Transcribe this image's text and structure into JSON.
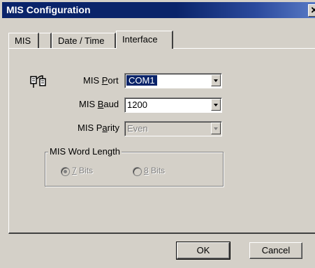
{
  "window": {
    "title": "MIS Configuration",
    "close_glyph": "✕"
  },
  "tabs": [
    {
      "label": "MIS",
      "active": false
    },
    {
      "label": "Date / Time",
      "active": false
    },
    {
      "label": "Interface",
      "active": true
    }
  ],
  "interface": {
    "port": {
      "label_pre": "MIS ",
      "label_mnemonic": "P",
      "label_post": "ort",
      "value": "COM1",
      "icon": "plug-connector-icon"
    },
    "baud": {
      "label_pre": "MIS ",
      "label_mnemonic": "B",
      "label_post": "aud",
      "value": "1200"
    },
    "parity": {
      "label_pre": "MIS P",
      "label_mnemonic": "a",
      "label_post": "rity",
      "value": "Even",
      "disabled": true
    },
    "word_length": {
      "title": "MIS Word Length",
      "options": [
        {
          "mnemonic": "7",
          "label_post": " Bits",
          "checked": true,
          "disabled": true
        },
        {
          "mnemonic": "8",
          "label_post": " Bits",
          "checked": false,
          "disabled": true
        }
      ]
    }
  },
  "buttons": {
    "ok": "OK",
    "cancel": "Cancel"
  },
  "colors": {
    "titlebar": "#0a246a",
    "dialog": "#d4d0c8",
    "selection": "#0a246a"
  }
}
